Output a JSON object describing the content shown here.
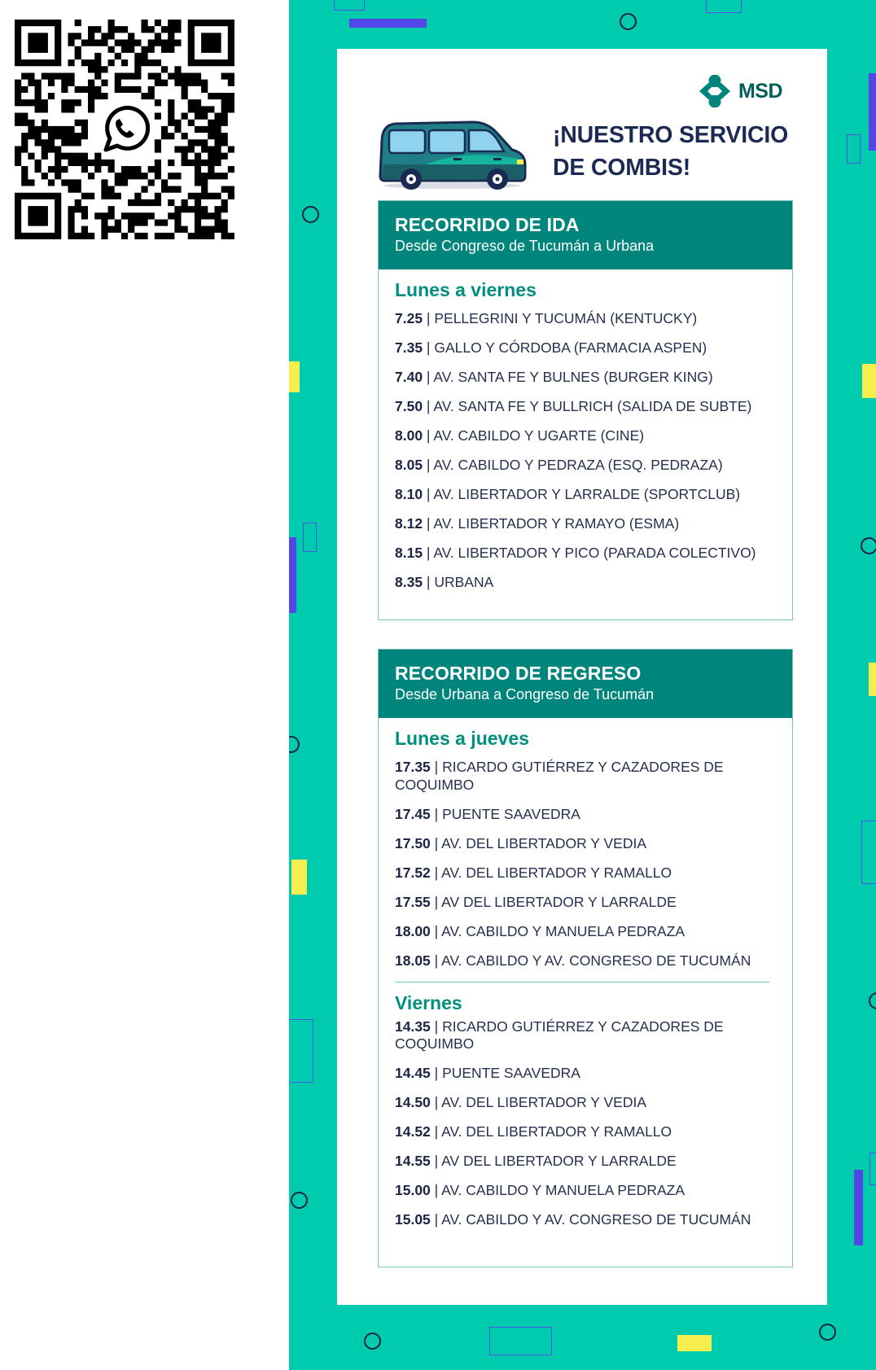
{
  "colors": {
    "teal": "#00cbae",
    "dark_teal": "#00857c",
    "navy": "#1b2a52",
    "violet": "#5246e6",
    "yellow": "#f6ee4f"
  },
  "qr": {
    "icon": "whatsapp-icon"
  },
  "brand": {
    "name": "MSD"
  },
  "title": {
    "line1": "¡NUESTRO SERVICIO",
    "line2": "DE COMBIS!"
  },
  "ida": {
    "title": "RECORRIDO DE IDA",
    "subtitle": "Desde Congreso de Tucumán a Urbana",
    "day": "Lunes a viernes",
    "stops": [
      {
        "time": "7.25",
        "place": "PELLEGRINI Y TUCUMÁN (KENTUCKY)"
      },
      {
        "time": "7.35",
        "place": "GALLO Y CÓRDOBA (FARMACIA ASPEN)"
      },
      {
        "time": "7.40",
        "place": "AV. SANTA FE Y BULNES (BURGER KING)"
      },
      {
        "time": "7.50",
        "place": "AV. SANTA FE Y BULLRICH (SALIDA DE SUBTE)"
      },
      {
        "time": "8.00",
        "place": "AV. CABILDO Y UGARTE (CINE)"
      },
      {
        "time": "8.05",
        "place": "AV. CABILDO Y PEDRAZA (ESQ. PEDRAZA)"
      },
      {
        "time": "8.10",
        "place": "AV. LIBERTADOR Y LARRALDE (SPORTCLUB)"
      },
      {
        "time": "8.12",
        "place": "AV. LIBERTADOR Y RAMAYO (ESMA)"
      },
      {
        "time": "8.15",
        "place": "AV. LIBERTADOR Y PICO (PARADA COLECTIVO)"
      },
      {
        "time": "8.35",
        "place": "URBANA"
      }
    ]
  },
  "regreso": {
    "title": "RECORRIDO DE REGRESO",
    "subtitle": "Desde Urbana a Congreso de Tucumán",
    "groups": [
      {
        "day": "Lunes a jueves",
        "stops": [
          {
            "time": "17.35",
            "place": "RICARDO GUTIÉRREZ Y CAZADORES DE COQUIMBO"
          },
          {
            "time": "17.45",
            "place": "PUENTE SAAVEDRA"
          },
          {
            "time": "17.50",
            "place": "AV. DEL LIBERTADOR Y VEDIA"
          },
          {
            "time": "17.52",
            "place": "AV. DEL LIBERTADOR Y RAMALLO"
          },
          {
            "time": "17.55",
            "place": "AV DEL LIBERTADOR Y LARRALDE"
          },
          {
            "time": "18.00",
            "place": "AV. CABILDO Y MANUELA PEDRAZA"
          },
          {
            "time": "18.05",
            "place": "AV. CABILDO Y AV. CONGRESO DE TUCUMÁN"
          }
        ]
      },
      {
        "day": "Viernes",
        "stops": [
          {
            "time": "14.35",
            "place": "RICARDO GUTIÉRREZ Y CAZADORES DE COQUIMBO"
          },
          {
            "time": "14.45",
            "place": "PUENTE SAAVEDRA"
          },
          {
            "time": "14.50",
            "place": "AV. DEL LIBERTADOR Y VEDIA"
          },
          {
            "time": "14.52",
            "place": "AV. DEL LIBERTADOR Y RAMALLO"
          },
          {
            "time": "14.55",
            "place": "AV DEL LIBERTADOR Y LARRALDE"
          },
          {
            "time": "15.00",
            "place": "AV. CABILDO Y MANUELA PEDRAZA"
          },
          {
            "time": "15.05",
            "place": "AV. CABILDO Y AV. CONGRESO DE TUCUMÁN"
          }
        ]
      }
    ]
  }
}
